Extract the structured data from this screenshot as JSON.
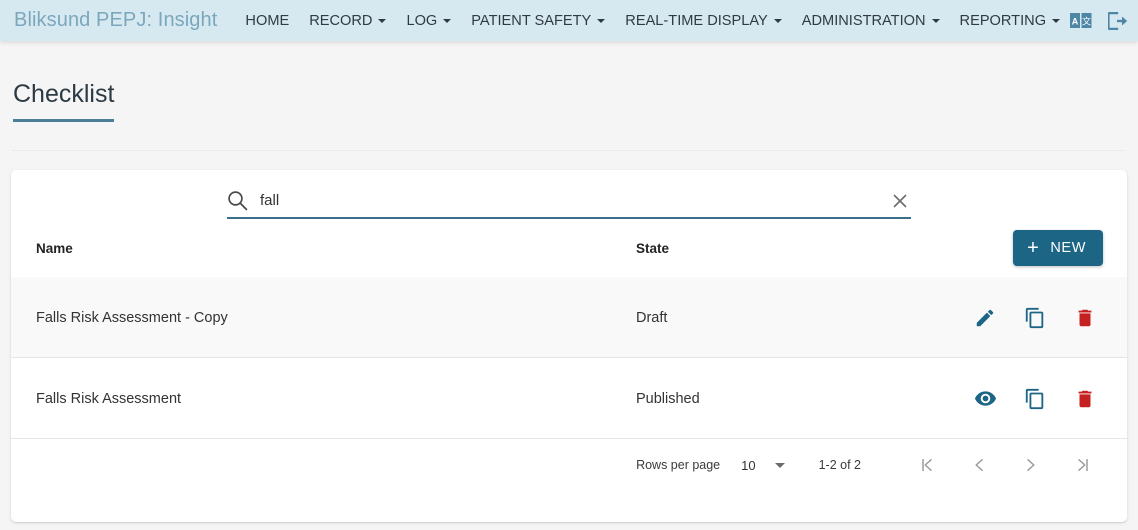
{
  "navbar": {
    "brand": "Bliksund PEPJ: Insight",
    "items": [
      {
        "label": "HOME",
        "has_caret": false
      },
      {
        "label": "RECORD",
        "has_caret": true
      },
      {
        "label": "LOG",
        "has_caret": true
      },
      {
        "label": "PATIENT SAFETY",
        "has_caret": true
      },
      {
        "label": "REAL-TIME DISPLAY",
        "has_caret": true
      },
      {
        "label": "ADMINISTRATION",
        "has_caret": true
      },
      {
        "label": "REPORTING",
        "has_caret": true
      }
    ],
    "right_icons": [
      {
        "name": "translate-icon"
      },
      {
        "name": "logout-icon"
      }
    ]
  },
  "page": {
    "title": "Checklist"
  },
  "search": {
    "icon": "search-icon",
    "value": "fall",
    "placeholder": "",
    "clear_icon": "close-icon"
  },
  "table": {
    "columns": [
      "Name",
      "State"
    ],
    "new_button": {
      "label": "NEW",
      "icon": "plus-icon"
    },
    "rows": [
      {
        "name": "Falls Risk Assessment - Copy",
        "state": "Draft",
        "actions": [
          "edit-icon",
          "copy-icon",
          "delete-icon"
        ]
      },
      {
        "name": "Falls Risk Assessment",
        "state": "Published",
        "actions": [
          "view-icon",
          "copy-icon",
          "delete-icon"
        ]
      }
    ]
  },
  "paginator": {
    "rows_per_page_label": "Rows per page",
    "rows_per_page_value": "10",
    "range_label": "1-2 of 2",
    "buttons": [
      "first-page-icon",
      "previous-page-icon",
      "next-page-icon",
      "last-page-icon"
    ]
  },
  "colors": {
    "navbar_bg": "#d7e9f0",
    "brand_text": "#7ba7bd",
    "accent": "#1d6585",
    "title_underline": "#4b7e99",
    "icon_blue": "#1d6585",
    "delete_red": "#c62121",
    "page_bg": "#f5f5f5"
  }
}
